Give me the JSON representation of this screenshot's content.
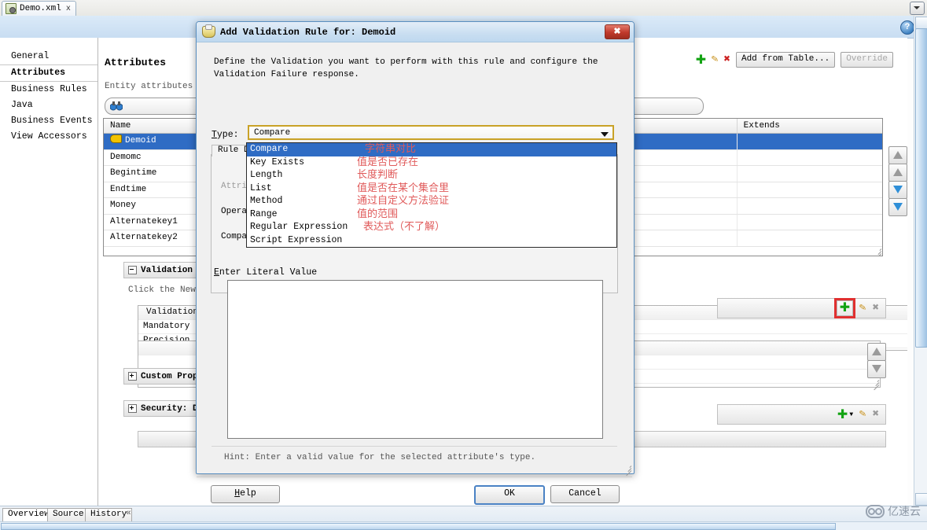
{
  "editor": {
    "file_tab": {
      "label": "Demo.xml",
      "close": "x",
      "icon": "xml-file-icon"
    },
    "bottom_tabs": [
      {
        "label": "Overview",
        "active": true
      },
      {
        "label": "Source",
        "active": false
      },
      {
        "label": "History",
        "active": false
      }
    ],
    "bottom_overflow": "«"
  },
  "sidebar": {
    "items": [
      {
        "label": "General",
        "selected": false
      },
      {
        "label": "Attributes",
        "selected": true
      },
      {
        "label": "Business Rules",
        "selected": false
      },
      {
        "label": "Java",
        "selected": false
      },
      {
        "label": "Business Events",
        "selected": false
      },
      {
        "label": "View Accessors",
        "selected": false
      }
    ]
  },
  "main": {
    "title": "Attributes",
    "description": "Entity attributes c",
    "search_placeholder": "",
    "search_icon": "binoculars-icon",
    "toolbar": {
      "add_icon": "plus-icon",
      "edit_icon": "pencil-icon",
      "delete_icon": "red-x-icon",
      "add_from_table_label": "Add from Table...",
      "override_label": "Override"
    },
    "table": {
      "columns": [
        "Name",
        "",
        "Extends"
      ],
      "rows": [
        {
          "name": "Demoid",
          "key": true,
          "selected": true,
          "extends": ""
        },
        {
          "name": "Demomc",
          "key": false,
          "selected": false,
          "extends": ""
        },
        {
          "name": "Begintime",
          "key": false,
          "selected": false,
          "extends": ""
        },
        {
          "name": "Endtime",
          "key": false,
          "selected": false,
          "extends": ""
        },
        {
          "name": "Money",
          "key": false,
          "selected": false,
          "extends": ""
        },
        {
          "name": "Alternatekey1",
          "key": false,
          "selected": false,
          "extends": ""
        },
        {
          "name": "Alternatekey2",
          "key": false,
          "selected": false,
          "extends": ""
        }
      ]
    },
    "sections": [
      {
        "label": "Validation Ru",
        "expanded": true
      },
      {
        "label": "Custom Proper",
        "expanded": false
      },
      {
        "label": "Security: Dem",
        "expanded": false
      }
    ],
    "validation": {
      "hint": "Click the New b",
      "col_header": "Validation ",
      "rows": [
        "Mandatory",
        "Precision :"
      ]
    },
    "side_buttons": {
      "move_top": "arrow-up-gray-icon",
      "move_up": "arrow-up-gray-icon",
      "move_down": "arrow-down-blue-icon",
      "move_bottom": "arrow-down-blue-icon",
      "up": "arrow-up-gray-icon",
      "down": "arrow-down-gray-icon"
    },
    "row_toolbars": {
      "add": "plus-icon",
      "add_menu": "plus-dropdown-icon",
      "edit": "pencil-icon",
      "delete": "gray-x-icon"
    },
    "help_icon": "help-question-icon",
    "view_menu_icon": "chevron-down-icon"
  },
  "dialog": {
    "title": "Add Validation Rule for: Demoid",
    "title_icon": "validation-rule-icon",
    "close_label": "✖",
    "description": "Define the Validation you want to perform with this rule and configure the Validation Failure response.",
    "type_label": "Type:",
    "type_value": "Compare",
    "type_arrow_icon": "chevron-down-icon",
    "dropdown_open": true,
    "dropdown_items": [
      {
        "label": "Compare",
        "note": "字符串对比",
        "selected": true
      },
      {
        "label": "Key Exists",
        "note": "值是否已存在",
        "selected": false
      },
      {
        "label": "Length",
        "note": "长度判断",
        "selected": false
      },
      {
        "label": "List",
        "note": "值是否在某个集合里",
        "selected": false
      },
      {
        "label": "Method",
        "note": "通过自定义方法验证",
        "selected": false
      },
      {
        "label": "Range",
        "note": "值的范围",
        "selected": false
      },
      {
        "label": "Regular Expression",
        "note": "表达式（不了解）",
        "selected": false
      },
      {
        "label": "Script Expression",
        "note": "",
        "selected": false
      }
    ],
    "rule_tab_label": "Rule D",
    "field_labels": [
      "Attri",
      "Opera",
      "Compa"
    ],
    "literal_label": "Enter Literal Value",
    "literal_value": "",
    "hint": "Hint: Enter a valid value for the selected attribute's type.",
    "buttons": {
      "help": "Help",
      "ok": "OK",
      "cancel": "Cancel"
    }
  },
  "watermark": {
    "text": "亿速云",
    "icon": "cloud-icon"
  },
  "colors": {
    "selection_blue": "#2f6cc4",
    "annotation_red": "#e05a5a",
    "highlight_red": "#e03030",
    "combo_focus": "#c9a227"
  }
}
